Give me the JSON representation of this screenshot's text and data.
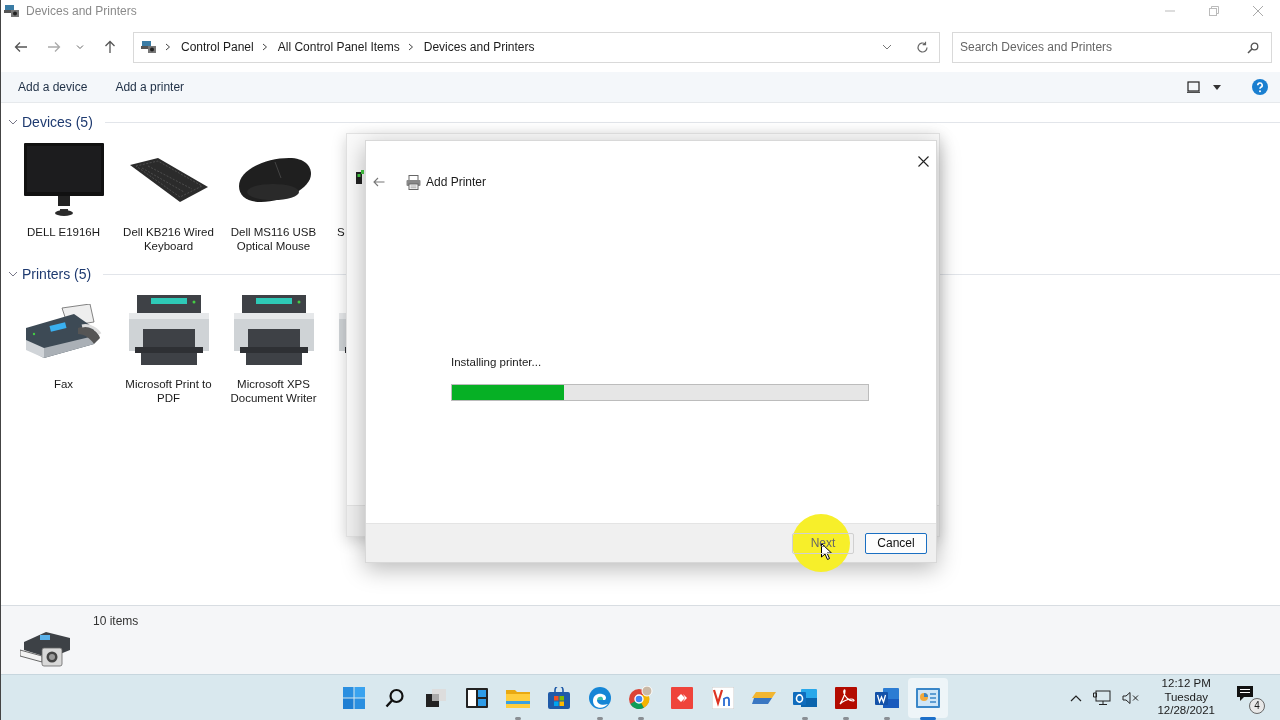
{
  "window": {
    "title": "Devices and Printers"
  },
  "address_bar": {
    "breadcrumbs": [
      "Control Panel",
      "All Control Panel Items",
      "Devices and Printers"
    ]
  },
  "search": {
    "placeholder": "Search Devices and Printers"
  },
  "commands": [
    "Add a device",
    "Add a printer"
  ],
  "groups": [
    {
      "title": "Devices (5)",
      "expanded": true,
      "items": [
        {
          "label": "DELL E1916H",
          "kind": "monitor",
          "cut": false
        },
        {
          "label": "Dell KB216 Wired Keyboard",
          "kind": "keyboard",
          "cut": false
        },
        {
          "label": "Dell MS116 USB Optical Mouse",
          "kind": "mouse",
          "cut": false
        },
        {
          "label": "S",
          "kind": "unknown",
          "cut": true
        }
      ]
    },
    {
      "title": "Printers (5)",
      "expanded": true,
      "items": [
        {
          "label": "Fax",
          "kind": "fax",
          "cut": false
        },
        {
          "label": "Microsoft Print to PDF",
          "kind": "printer",
          "cut": false
        },
        {
          "label": "Microsoft XPS Document Writer",
          "kind": "printer",
          "cut": false
        },
        {
          "kind": "printer",
          "cut": true
        }
      ]
    }
  ],
  "dialog": {
    "title": "Add Printer",
    "status": "Installing printer...",
    "progress": {
      "level": 0.27
    },
    "buttons": [
      {
        "label": "Next",
        "disabled": true
      },
      {
        "label": "Cancel",
        "disabled": false
      }
    ]
  },
  "status_bar": {
    "count": "10 items"
  },
  "taskbar": {
    "apps": [
      {
        "kind": "start",
        "running": false,
        "active": false
      },
      {
        "kind": "search",
        "running": false,
        "active": false
      },
      {
        "kind": "taskview",
        "running": false,
        "active": false
      },
      {
        "kind": "widgets",
        "running": false,
        "active": false
      },
      {
        "kind": "explorer",
        "running": true,
        "active": false
      },
      {
        "kind": "store",
        "running": false,
        "active": false
      },
      {
        "kind": "edge",
        "running": true,
        "active": false
      },
      {
        "kind": "chrome",
        "running": true,
        "active": false
      },
      {
        "kind": "anydesk",
        "running": false,
        "active": false
      },
      {
        "kind": "vnc",
        "running": false,
        "active": false
      },
      {
        "kind": "tool",
        "running": false,
        "active": false
      },
      {
        "kind": "outlook",
        "running": true,
        "active": false
      },
      {
        "kind": "acrobat",
        "running": true,
        "active": false
      },
      {
        "kind": "word",
        "running": true,
        "active": false
      },
      {
        "kind": "controlpanel",
        "running": true,
        "active": true
      }
    ],
    "volume": {
      "muted": true
    },
    "clock": {
      "time": "12:12 PM",
      "day": "Tuesday",
      "date": "12/28/2021"
    },
    "notifications": {
      "count": "4"
    }
  }
}
